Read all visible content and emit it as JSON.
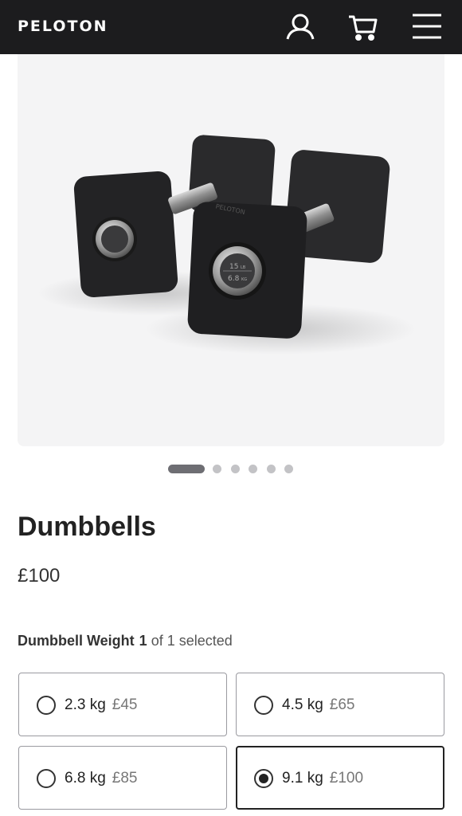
{
  "header": {
    "logo": "PELOTON",
    "icons": [
      "account-icon",
      "cart-icon",
      "menu-icon"
    ]
  },
  "gallery": {
    "image_alt": "Dumbbells",
    "dumbbell_engraving": {
      "brand": "PELOTON",
      "weight_lb": "15",
      "unit_lb": "LB",
      "weight_kg": "6.8",
      "unit_kg": "KG"
    },
    "slide_count": 6,
    "active_slide": 1
  },
  "product": {
    "title": "Dumbbells",
    "price": "£100"
  },
  "weight_selector": {
    "label": "Dumbbell Weight",
    "selected_count": "1",
    "selected_suffix": "of 1 selected",
    "options": [
      {
        "weight": "2.3 kg",
        "price": "£45",
        "selected": false
      },
      {
        "weight": "4.5 kg",
        "price": "£65",
        "selected": false
      },
      {
        "weight": "6.8 kg",
        "price": "£85",
        "selected": false
      },
      {
        "weight": "9.1 kg",
        "price": "£100",
        "selected": true
      }
    ]
  },
  "colors": {
    "header_bg": "#1c1c1e",
    "text": "#222222",
    "muted": "#777777",
    "dot_active": "#6e6e73",
    "dot_inactive": "#c3c3c6"
  }
}
